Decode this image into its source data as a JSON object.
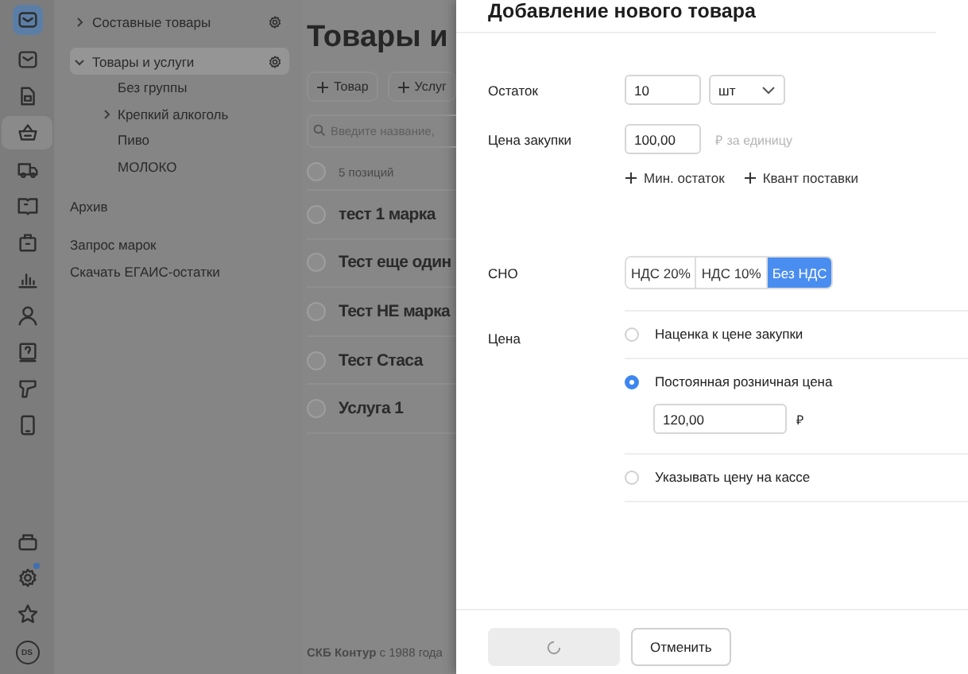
{
  "rail": {
    "items": [
      {
        "selected": false,
        "logo": true
      },
      {
        "selected": false
      },
      {
        "selected": false
      },
      {
        "selected": true
      },
      {
        "selected": false
      },
      {
        "selected": false
      },
      {
        "selected": false
      },
      {
        "selected": false
      },
      {
        "selected": false
      },
      {
        "selected": false
      },
      {
        "selected": false
      },
      {
        "selected": false
      }
    ],
    "bottom": [
      {
        "badge": false
      },
      {
        "badge": true
      },
      {
        "badge": false
      }
    ],
    "avatar": "DS"
  },
  "nav": {
    "tree": [
      {
        "label": "Составные товары",
        "expanded": false,
        "selected": false,
        "settings": true
      },
      {
        "label": "Товары и услуги",
        "expanded": true,
        "selected": true,
        "settings": true,
        "children": [
          {
            "label": "Без группы",
            "expandable": false
          },
          {
            "label": "Крепкий алкоголь",
            "expandable": true
          },
          {
            "label": "Пиво",
            "expandable": false
          },
          {
            "label": "МОЛОКО",
            "expandable": false
          }
        ]
      }
    ],
    "archive": "Архив",
    "links": [
      "Запрос марок",
      "Скачать ЕГАИС-остатки"
    ]
  },
  "main": {
    "title": "Товары и",
    "buttons": [
      "Товар",
      "Услуг"
    ],
    "search": {
      "placeholder": "Введите название,"
    },
    "count": {
      "label": "5 позиций",
      "checked": false
    },
    "rows": [
      {
        "name": "тест 1 марка",
        "checked": false
      },
      {
        "name": "Тест еще один",
        "checked": false
      },
      {
        "name": "Тест НЕ марка",
        "checked": false
      },
      {
        "name": "Тест Стаса",
        "checked": false
      },
      {
        "name": "Услуга 1",
        "checked": false
      }
    ],
    "footer": "**СКБ Контур** с 1988 года"
  },
  "dialog": {
    "title": "Добавление нового товара",
    "stock": {
      "label": "Остаток",
      "value": "10",
      "unit": "шт"
    },
    "purchase": {
      "label": "Цена закупки",
      "value": "100,00",
      "hint": "₽ за единицу"
    },
    "add_links": [
      "Мин. остаток",
      "Квант поставки"
    ],
    "tax": {
      "label": "СНО",
      "options": [
        {
          "label": "НДС 20%",
          "selected": false
        },
        {
          "label": "НДС 10%",
          "selected": false
        },
        {
          "label": "Без НДС",
          "selected": true
        }
      ]
    },
    "price": {
      "label": "Цена",
      "options": [
        {
          "label": "Наценка к цене закупки",
          "selected": false
        },
        {
          "label": "Постоянная розничная цена",
          "selected": true,
          "value": "120,00",
          "currency": "₽"
        },
        {
          "label": "Указывать цену на кассе",
          "selected": false
        }
      ]
    },
    "submit": {
      "loading": true
    },
    "cancel": "Отменить"
  }
}
